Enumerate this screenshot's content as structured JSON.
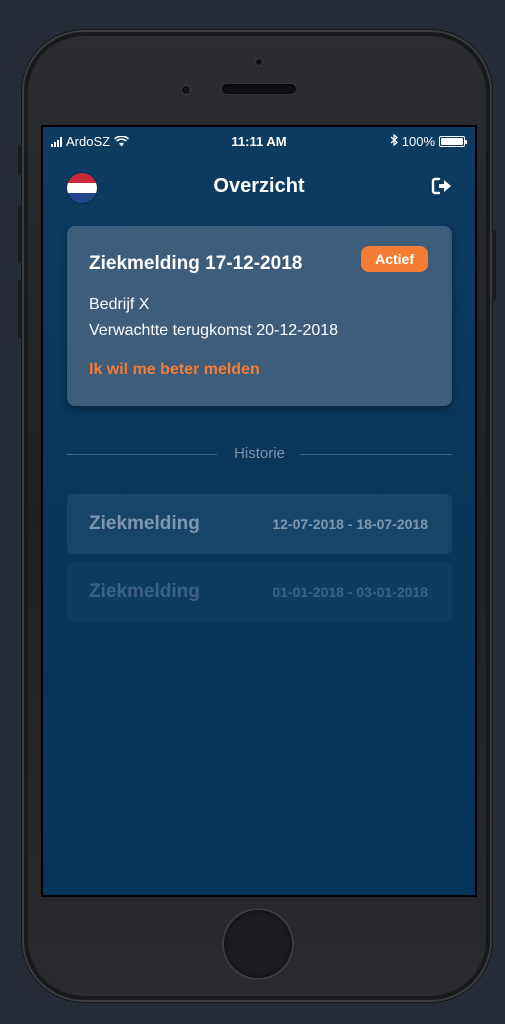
{
  "status_bar": {
    "carrier": "ArdoSZ",
    "time": "11:11 AM",
    "battery": "100%",
    "bluetooth_icon": "bluetooth-icon",
    "wifi_icon": "wifi-icon"
  },
  "nav": {
    "title": "Overzicht",
    "flag_icon": "dutch-flag-icon",
    "logout_icon": "sign-out-icon"
  },
  "active_card": {
    "title": "Ziekmelding 17-12-2018",
    "badge": "Actief",
    "company": "Bedrijf X",
    "expected_return": "Verwachtte terugkomst 20-12-2018",
    "action_link": "Ik wil me beter melden"
  },
  "history": {
    "label": "Historie",
    "items": [
      {
        "title": "Ziekmelding",
        "dates": "12-07-2018 - 18-07-2018"
      },
      {
        "title": "Ziekmelding",
        "dates": "01-01-2018 - 03-01-2018"
      }
    ]
  },
  "colors": {
    "background": "#0a3a60",
    "card": "#3d5d7b",
    "accent": "#f47c34"
  }
}
